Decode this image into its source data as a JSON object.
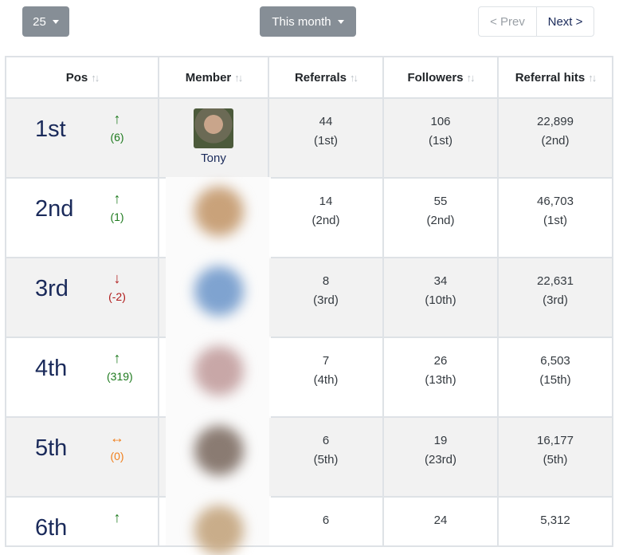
{
  "controls": {
    "per_page": "25",
    "period": "This month",
    "prev_label": "< Prev",
    "next_label": "Next >"
  },
  "table": {
    "headers": [
      "Pos",
      "Member",
      "Referrals",
      "Followers",
      "Referral hits"
    ],
    "sort_icon": "↑↓",
    "rows": [
      {
        "pos": "1st",
        "dir": "up",
        "arrow": "↑",
        "change": "(6)",
        "member": "Tony",
        "referrals": "44",
        "referrals_rank": "(1st)",
        "followers": "106",
        "followers_rank": "(1st)",
        "hits": "22,899",
        "hits_rank": "(2nd)"
      },
      {
        "pos": "2nd",
        "dir": "up",
        "arrow": "↑",
        "change": "(1)",
        "member": "",
        "referrals": "14",
        "referrals_rank": "(2nd)",
        "followers": "55",
        "followers_rank": "(2nd)",
        "hits": "46,703",
        "hits_rank": "(1st)"
      },
      {
        "pos": "3rd",
        "dir": "down",
        "arrow": "↓",
        "change": "(-2)",
        "member": "",
        "referrals": "8",
        "referrals_rank": "(3rd)",
        "followers": "34",
        "followers_rank": "(10th)",
        "hits": "22,631",
        "hits_rank": "(3rd)"
      },
      {
        "pos": "4th",
        "dir": "up",
        "arrow": "↑",
        "change": "(319)",
        "member": "",
        "referrals": "7",
        "referrals_rank": "(4th)",
        "followers": "26",
        "followers_rank": "(13th)",
        "hits": "6,503",
        "hits_rank": "(15th)"
      },
      {
        "pos": "5th",
        "dir": "neutral",
        "arrow": "↔",
        "change": "(0)",
        "member": "",
        "referrals": "6",
        "referrals_rank": "(5th)",
        "followers": "19",
        "followers_rank": "(23rd)",
        "hits": "16,177",
        "hits_rank": "(5th)"
      },
      {
        "pos": "6th",
        "dir": "up",
        "arrow": "↑",
        "change": "",
        "member": "",
        "referrals": "6",
        "referrals_rank": "",
        "followers": "24",
        "followers_rank": "",
        "hits": "5,312",
        "hits_rank": ""
      }
    ]
  },
  "colors": {
    "button_gray": "#868e96",
    "rank_navy": "#1a2a5a",
    "up_green": "#1e7a1e",
    "down_red": "#b01b1b",
    "neutral_orange": "#f07f1c",
    "row_stripe": "#f2f2f2"
  },
  "icons": {
    "dropdown": "caret-down-icon",
    "sort": "sort-arrows-icon",
    "up": "arrow-up-icon",
    "down": "arrow-down-icon",
    "neutral": "arrow-left-right-icon"
  }
}
